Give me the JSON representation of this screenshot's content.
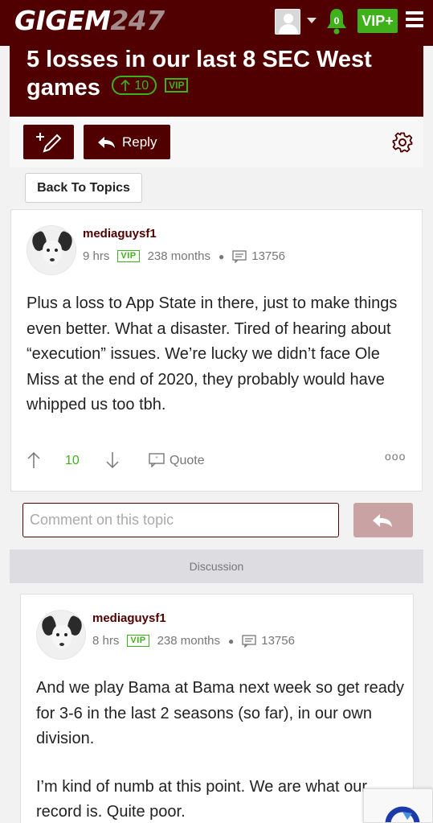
{
  "header": {
    "logo_main": "GIGEM",
    "logo_num": "247",
    "notification_count": "0",
    "vip_plus_label": "VIP+"
  },
  "topic": {
    "title": "5 losses in our last 8 SEC West games",
    "vote_count": "10",
    "vip_label": "VIP"
  },
  "toolbar": {
    "reply_label": "Reply",
    "back_label": "Back To Topics"
  },
  "original_post": {
    "username": "mediaguysf1",
    "time": "9 hrs",
    "vip_label": "VIP",
    "tenure": "238 months",
    "post_count": "13756",
    "body": "Plus a loss to App State in there, just to make things even better. What a disaster. Tired of hearing about “execution” issues. We’re lucky we didn’t face Ole Miss at the end of 2020, they probably would have whipped us too tbh.",
    "vote_count": "10",
    "quote_label": "Quote",
    "more_label": "ooo"
  },
  "comment": {
    "placeholder": "Comment on this topic"
  },
  "discussion_label": "Discussion",
  "reply_post": {
    "username": "mediaguysf1",
    "time": "8 hrs",
    "vip_label": "VIP",
    "tenure": "238 months",
    "post_count": "13756",
    "paragraph_1": "And we play Bama at Bama next week so get ready for 3-6 in the last 2 seasons (so far), in our own division.",
    "paragraph_2": "I’m kind of numb at this point. We are what our record is. Quite poor."
  },
  "colors": {
    "brand_maroon": "#500000",
    "vip_green": "#3fb21b",
    "send_disabled": "#c9a3a3"
  }
}
